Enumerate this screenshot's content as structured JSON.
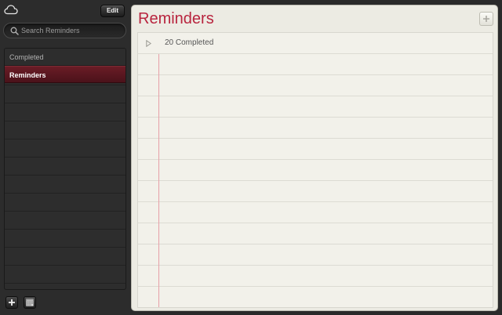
{
  "sidebar": {
    "edit_label": "Edit",
    "search": {
      "placeholder": "Search Reminders",
      "value": ""
    },
    "items": [
      {
        "label": "Completed",
        "selected": false
      },
      {
        "label": "Reminders",
        "selected": true
      }
    ],
    "icons": {
      "account": "cloud-icon",
      "search": "search-icon",
      "add": "plus-icon",
      "calendar": "calendar-icon"
    }
  },
  "main": {
    "title": "Reminders",
    "completed_label": "20 Completed",
    "icons": {
      "add": "plus-icon",
      "disclosure": "triangle-right-icon"
    }
  },
  "colors": {
    "accent": "#b8243e",
    "selection": "#5a1820",
    "paper": "#f2f1ea",
    "margin_line": "#e7a0a8"
  }
}
